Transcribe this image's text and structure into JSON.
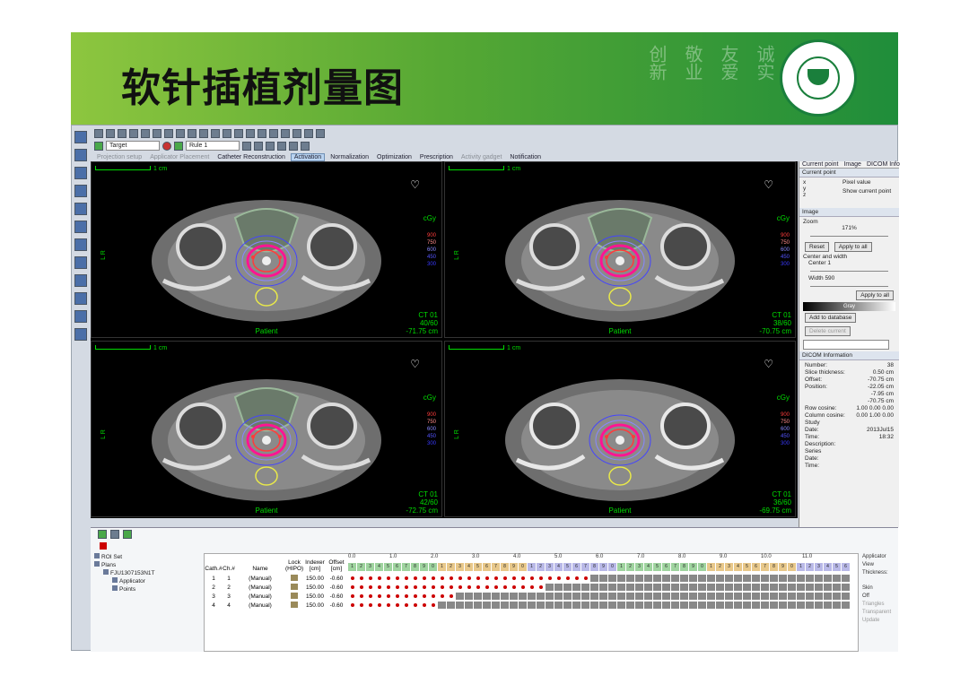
{
  "slide_title": "软针插植剂量图",
  "motto": [
    "创新",
    "敬业",
    "友爱",
    "诚实"
  ],
  "toolbar": {
    "target_select": "Target",
    "rule_select": "Rule 1"
  },
  "tabs": [
    {
      "label": "Projection setup",
      "state": "disabled"
    },
    {
      "label": "Applicator Placement",
      "state": "disabled"
    },
    {
      "label": "Catheter Reconstruction",
      "state": "done"
    },
    {
      "label": "Activation",
      "state": "active"
    },
    {
      "label": "Normalization",
      "state": "done"
    },
    {
      "label": "Optimization",
      "state": "done"
    },
    {
      "label": "Prescription",
      "state": "done"
    },
    {
      "label": "Activity gadget",
      "state": "disabled"
    },
    {
      "label": "Notification",
      "state": "warn"
    }
  ],
  "viewports": [
    {
      "scale": "1 cm",
      "unit": "cGy",
      "legend": [
        "900",
        "750",
        "600",
        "450",
        "300"
      ],
      "ct": "CT 01",
      "slice": "40/60",
      "pos": "-71.75 cm",
      "patient": "Patient"
    },
    {
      "scale": "1 cm",
      "unit": "cGy",
      "legend": [
        "900",
        "750",
        "600",
        "450",
        "300"
      ],
      "ct": "CT 01",
      "slice": "38/60",
      "pos": "-70.75 cm",
      "patient": "Patient"
    },
    {
      "scale": "1 cm",
      "unit": "cGy",
      "legend": [
        "900",
        "750",
        "600",
        "450",
        "300"
      ],
      "ct": "CT 01",
      "slice": "42/60",
      "pos": "-72.75 cm",
      "patient": "Patient"
    },
    {
      "scale": "1 cm",
      "unit": "cGy",
      "legend": [
        "900",
        "750",
        "600",
        "450",
        "300"
      ],
      "ct": "CT 01",
      "slice": "36/60",
      "pos": "-69.75 cm",
      "patient": "Patient"
    }
  ],
  "right_panel": {
    "tabs": [
      "Current point",
      "Image",
      "DICOM Info"
    ],
    "current_point": {
      "header": "Current point",
      "pixel_value": "Pixel value",
      "show_current": "Show current point",
      "axes": [
        "x",
        "y",
        "z"
      ]
    },
    "image": {
      "header": "Image",
      "zoom_label": "Zoom",
      "zoom_value": "171%",
      "reset": "Reset",
      "apply_all": "Apply to all",
      "center_width": "Center and width",
      "center_label": "Center",
      "center_value": "1",
      "width_label": "Width",
      "width_value": "590",
      "apply_to_all2": "Apply to all",
      "gray": "Gray",
      "add_db": "Add to database",
      "delete_current": "Delete current"
    },
    "dicom": {
      "header": "DICOM Information",
      "rows": [
        {
          "k": "Number:",
          "v": "38"
        },
        {
          "k": "Slice thickness:",
          "v": "0.50 cm"
        },
        {
          "k": "Offset:",
          "v": "-70.75 cm"
        },
        {
          "k": "Position:",
          "v": "-22.05 cm"
        },
        {
          "k": "",
          "v": "-7.95 cm"
        },
        {
          "k": "",
          "v": "-70.75 cm"
        },
        {
          "k": "Row cosine:",
          "v": "1.00 0.00 0.00"
        },
        {
          "k": "Column cosine:",
          "v": "0.00 1.00 0.00"
        },
        {
          "k": "Study",
          "v": ""
        },
        {
          "k": "Date:",
          "v": "2013Jul15"
        },
        {
          "k": "Time:",
          "v": "18:32"
        },
        {
          "k": "Description:",
          "v": ""
        },
        {
          "k": "Series",
          "v": ""
        },
        {
          "k": "Date:",
          "v": ""
        },
        {
          "k": "Time:",
          "v": ""
        }
      ]
    }
  },
  "tree": [
    {
      "label": "ROI Set",
      "indent": 0
    },
    {
      "label": "Plans",
      "indent": 0
    },
    {
      "label": "FJU1307153N1T",
      "indent": 1
    },
    {
      "label": "Applicator",
      "indent": 2
    },
    {
      "label": "Points",
      "indent": 2
    }
  ],
  "table": {
    "headers": [
      "Cath.#",
      "Ch.#",
      "Name",
      "Lock (HIPO)",
      "Indexer [cm]",
      "Offset [cm]"
    ],
    "ruler": [
      "0.0",
      "1.0",
      "2.0",
      "3.0",
      "4.0",
      "5.0",
      "6.0",
      "7.0",
      "8.0",
      "9.0",
      "10.0",
      "11.0"
    ],
    "rows": [
      {
        "cath": "1",
        "ch": "1",
        "name": "(Manual)",
        "indexer": "150.00",
        "offset": "-0.60",
        "active": 27
      },
      {
        "cath": "2",
        "ch": "2",
        "name": "(Manual)",
        "indexer": "150.00",
        "offset": "-0.60",
        "active": 22
      },
      {
        "cath": "3",
        "ch": "3",
        "name": "(Manual)",
        "indexer": "150.00",
        "offset": "-0.60",
        "active": 12
      },
      {
        "cath": "4",
        "ch": "4",
        "name": "(Manual)",
        "indexer": "150.00",
        "offset": "-0.60",
        "active": 10
      }
    ]
  },
  "applicator_view": {
    "title": "Applicator View",
    "thickness": "Thickness:",
    "skin": "Skin",
    "off": "Off",
    "triangles": "Triangles",
    "transparent": "Transparent",
    "update": "Update"
  }
}
